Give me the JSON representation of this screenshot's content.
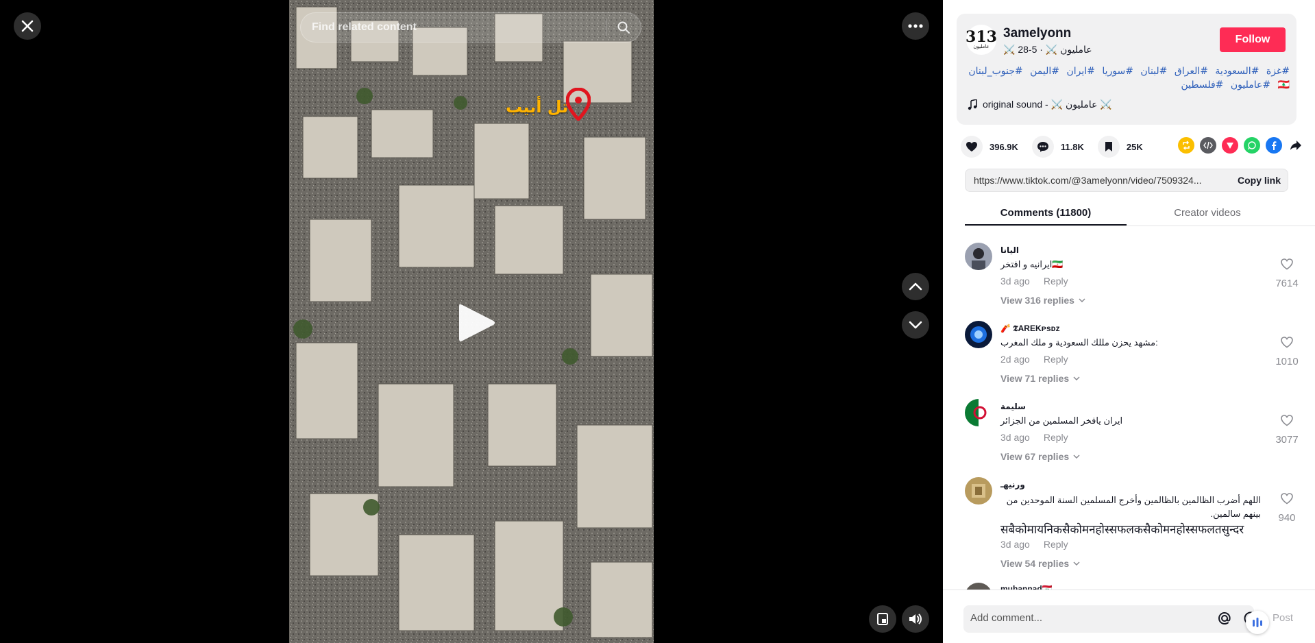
{
  "player": {
    "search_placeholder": "Find related content",
    "overlay_label": "تل أبيب"
  },
  "author": {
    "avatar_text": "313",
    "avatar_sub": "عامليون",
    "name": "3amelyonn",
    "subline": "⚔️ عامليون ⚔️ · 5-28",
    "follow_label": "Follow"
  },
  "description": {
    "hashtags": [
      "#غزة",
      "#السعودية",
      "#العراق",
      "#لبنان",
      "#سوريا",
      "#ايران",
      "#اليمن",
      "#جنوب_لبنان🇱🇧",
      "#عامليون",
      "#فلسطين"
    ],
    "music": "original sound - ⚔️ عامليون ⚔️"
  },
  "stats": {
    "likes": "396.9K",
    "comments": "11.8K",
    "saves": "25K"
  },
  "share": {
    "url": "https://www.tiktok.com/@3amelyonn/video/7509324...",
    "copy_label": "Copy link",
    "icons": [
      "repost-icon",
      "embed-icon",
      "send-icon",
      "whatsapp-icon",
      "facebook-icon",
      "share-arrow-icon"
    ]
  },
  "tabs": [
    {
      "label": "Comments (11800)",
      "active": true
    },
    {
      "label": "Creator videos",
      "active": false
    }
  ],
  "comments": [
    {
      "user": "اليانا",
      "text": "ايرانيه و افتخر🇮🇷",
      "time": "3d ago",
      "reply": "Reply",
      "view": "View 316 replies",
      "likes": "7614"
    },
    {
      "user": "🧨 𝕿AREKᴘsᴅᴢ",
      "text": "مشهد يحزن مللك السعودية و ملك المغرب:",
      "time": "2d ago",
      "reply": "Reply",
      "view": "View 71 replies",
      "likes": "1010"
    },
    {
      "user": "سليمة",
      "text": "ايران يافخر المسلمين من الجزائر",
      "time": "3d ago",
      "reply": "Reply",
      "view": "View 67 replies",
      "likes": "3077"
    },
    {
      "user": "ورنيهـ",
      "text": "اللهم أضرب الظالمين بالظالمين وأخرج المسلمين السنة الموحدين من بينهم سالمين.",
      "text2": "सबैकोमायनिकसैकोमनहोस्सफलकसैकोमनहोस्सफलतसुन्दर",
      "time": "3d ago",
      "reply": "Reply",
      "view": "View 54 replies",
      "likes": "940"
    },
    {
      "user": "muhannad🇮🇶"
    }
  ],
  "composer": {
    "placeholder": "Add comment...",
    "post_label": "Post"
  },
  "colors": {
    "follow": "#fe2c55",
    "hashtag": "#2b5db9",
    "overlay_text": "#ffb300"
  }
}
